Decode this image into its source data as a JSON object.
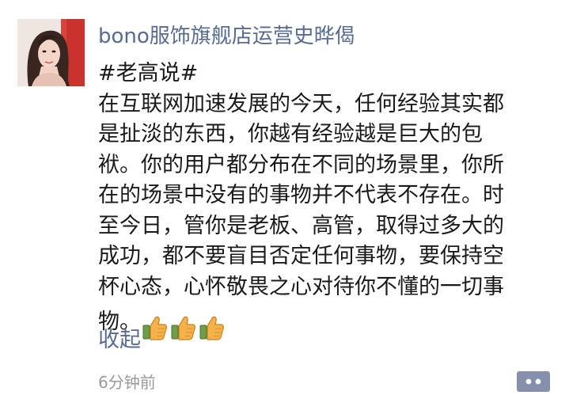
{
  "post": {
    "author": "bono服饰旗舰店运营史晔偈",
    "tag": "#老高说#",
    "lines": [
      "在互联网加速发展的今天，任何经验其实都",
      "是扯淡的东西，你越有经验越是巨大的包",
      "袱。你的用户都分布在不同的场景里，你所",
      "在的场景中没有的事物并不代表不存在。时",
      "至今日，管你是老板、高管，取得过多大的",
      "成功，都不要盲目否定任何事物，要保持空",
      "杯心态，心怀敬畏之心对待你不懂的一切事"
    ],
    "last_line": "物。",
    "emojis": [
      "thumbs-up-icon",
      "thumbs-up-icon",
      "thumbs-up-icon"
    ],
    "collapse_label": "收起",
    "timestamp": "6分钟前"
  },
  "colors": {
    "link": "#576b95",
    "text": "#1a1a1a",
    "meta": "#9a9a9a",
    "button_bg": "#8591ac"
  }
}
